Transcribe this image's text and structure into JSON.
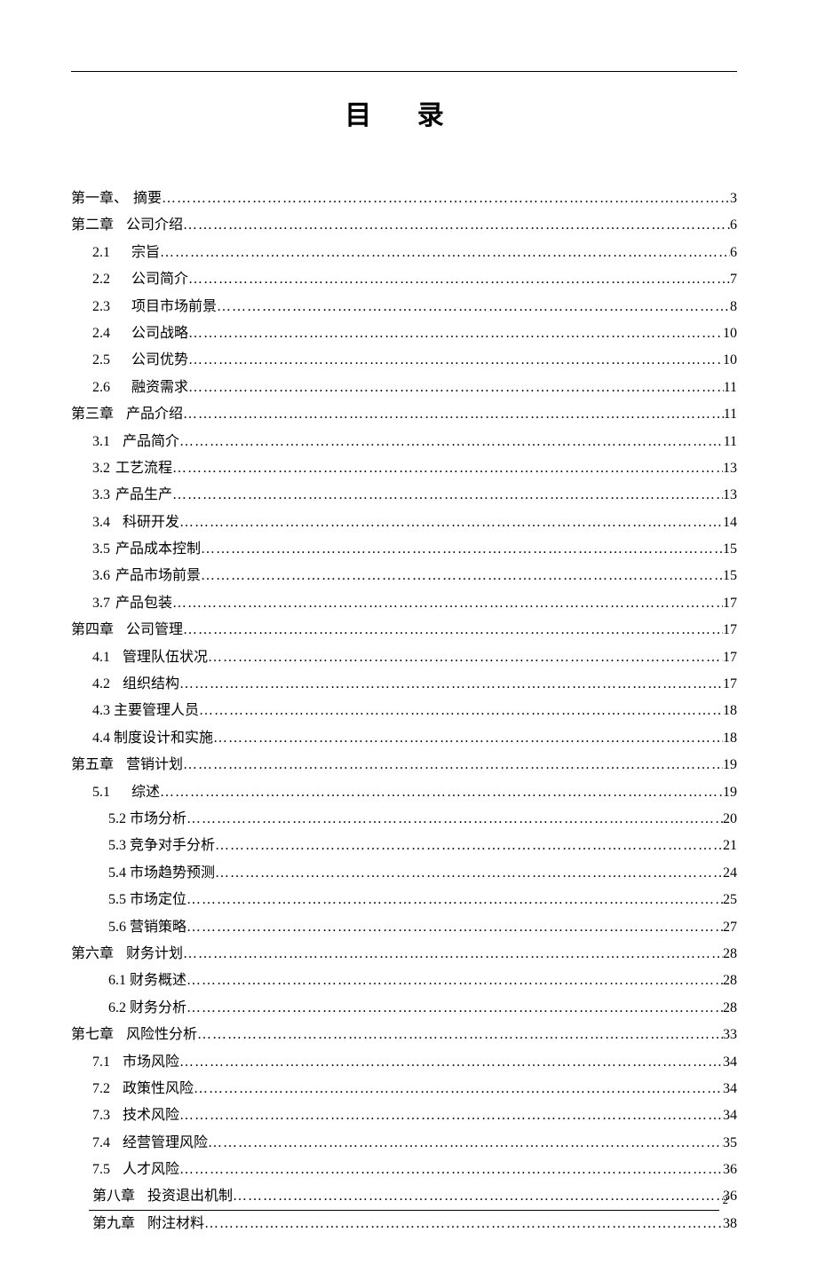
{
  "title": "目 录",
  "page_number": "2",
  "toc": [
    {
      "num": "第一章、",
      "label": "摘要",
      "page": "3",
      "indent": 0,
      "gap": "a"
    },
    {
      "num": "第二章",
      "label": "公司介绍",
      "page": "6",
      "indent": 0,
      "gap": "b"
    },
    {
      "num": "2.1",
      "label": "宗旨",
      "page": "6",
      "indent": 1,
      "gap": "c"
    },
    {
      "num": "2.2",
      "label": "公司简介",
      "page": "7",
      "indent": 1,
      "gap": "c"
    },
    {
      "num": "2.3",
      "label": "项目市场前景",
      "page": "8",
      "indent": 1,
      "gap": "c"
    },
    {
      "num": "2.4",
      "label": "公司战略",
      "page": "10",
      "indent": 1,
      "gap": "c"
    },
    {
      "num": "2.5",
      "label": "公司优势",
      "page": "10",
      "indent": 1,
      "gap": "c"
    },
    {
      "num": "2.6",
      "label": "融资需求",
      "page": "11",
      "indent": 1,
      "gap": "c"
    },
    {
      "num": "第三章",
      "label": "产品介绍",
      "page": "11",
      "indent": 0,
      "gap": "b"
    },
    {
      "num": "3.1",
      "label": "产品简介",
      "page": "11",
      "indent": 1,
      "gap": "b"
    },
    {
      "num": "3.2",
      "label": "工艺流程",
      "page": "13",
      "indent": 1,
      "gap": "a"
    },
    {
      "num": "3.3",
      "label": "产品生产",
      "page": "13",
      "indent": 1,
      "gap": "a"
    },
    {
      "num": "3.4",
      "label": "科研开发",
      "page": "14",
      "indent": 1,
      "gap": "b"
    },
    {
      "num": "3.5",
      "label": "产品成本控制",
      "page": "15",
      "indent": 1,
      "gap": "a"
    },
    {
      "num": "3.6",
      "label": "产品市场前景",
      "page": "15",
      "indent": 1,
      "gap": "a"
    },
    {
      "num": "3.7",
      "label": "产品包装",
      "page": "17",
      "indent": 1,
      "gap": "a"
    },
    {
      "num": "第四章",
      "label": "公司管理",
      "page": "17",
      "indent": 0,
      "gap": "b"
    },
    {
      "num": "4.1",
      "label": "管理队伍状况",
      "page": "17",
      "indent": 1,
      "gap": "b"
    },
    {
      "num": "4.2",
      "label": "组织结构",
      "page": "17",
      "indent": 1,
      "gap": "b"
    },
    {
      "num": "4.3",
      "label": "主要管理人员",
      "page": "18",
      "indent": 1,
      "gap": "d"
    },
    {
      "num": "4.4",
      "label": "制度设计和实施",
      "page": "18",
      "indent": 1,
      "gap": "d"
    },
    {
      "num": "第五章",
      "label": "营销计划",
      "page": "19",
      "indent": 0,
      "gap": "b"
    },
    {
      "num": "5.1",
      "label": "综述",
      "page": "19",
      "indent": 1,
      "gap": "c"
    },
    {
      "num": "5.2",
      "label": "市场分析",
      "page": "20",
      "indent": 2,
      "gap": "d"
    },
    {
      "num": "5.3",
      "label": "竞争对手分析",
      "page": "21",
      "indent": 2,
      "gap": "d"
    },
    {
      "num": "5.4",
      "label": "市场趋势预测",
      "page": "24",
      "indent": 2,
      "gap": "d"
    },
    {
      "num": "5.5",
      "label": "市场定位",
      "page": "25",
      "indent": 2,
      "gap": "d"
    },
    {
      "num": "5.6",
      "label": "营销策略",
      "page": "27",
      "indent": 2,
      "gap": "d"
    },
    {
      "num": "第六章",
      "label": "财务计划",
      "page": "28",
      "indent": 0,
      "gap": "b"
    },
    {
      "num": "6.1",
      "label": "财务概述",
      "page": "28",
      "indent": 2,
      "gap": "d"
    },
    {
      "num": "6.2",
      "label": "财务分析",
      "page": "28",
      "indent": 2,
      "gap": "d"
    },
    {
      "num": "第七章",
      "label": "风险性分析",
      "page": "33",
      "indent": 0,
      "gap": "b"
    },
    {
      "num": "7.1",
      "label": "市场风险",
      "page": "34",
      "indent": 1,
      "gap": "b"
    },
    {
      "num": "7.2",
      "label": "政策性风险",
      "page": "34",
      "indent": 1,
      "gap": "b"
    },
    {
      "num": "7.3",
      "label": "技术风险",
      "page": "34",
      "indent": 1,
      "gap": "b"
    },
    {
      "num": "7.4",
      "label": "经营管理风险",
      "page": "35",
      "indent": 1,
      "gap": "b"
    },
    {
      "num": "7.5",
      "label": "人才风险",
      "page": "36",
      "indent": 1,
      "gap": "b"
    },
    {
      "num": "第八章",
      "label": "投资退出机制",
      "page": "36",
      "indent": 1,
      "gap": "b"
    },
    {
      "num": "第九章",
      "label": "附注材料",
      "page": "38",
      "indent": 1,
      "gap": "b"
    }
  ]
}
